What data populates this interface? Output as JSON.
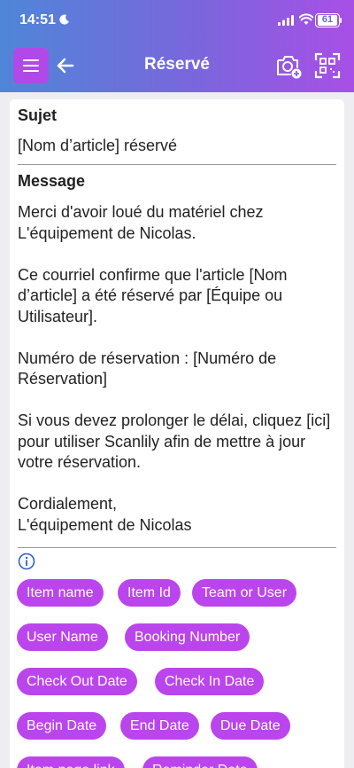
{
  "status_bar": {
    "time": "14:51",
    "battery": "61"
  },
  "header": {
    "title": "Réservé"
  },
  "form": {
    "subject_label": "Sujet",
    "subject_value": "[Nom d’article] réservé",
    "message_label": "Message",
    "message_value": "Merci d'avoir loué du matériel chez L'équipement de Nicolas.\n\nCe courriel confirme que l'article [Nom d’article] a été réservé par [Équipe ou Utilisateur].\n\nNuméro de réservation : [Numéro de Réservation]\n\nSi vous devez prolonger le délai, cliquez [ici] pour utiliser Scanlily afin de mettre à jour votre réservation.\n\nCordialement,\nL'équipement de Nicolas"
  },
  "chips": [
    "Item name",
    "Item Id",
    "Team or User",
    "User Name",
    "Booking Number",
    "Check Out Date",
    "Check In Date",
    "Begin Date",
    "End Date",
    "Due Date",
    "Item page link",
    "Reminder Date"
  ]
}
